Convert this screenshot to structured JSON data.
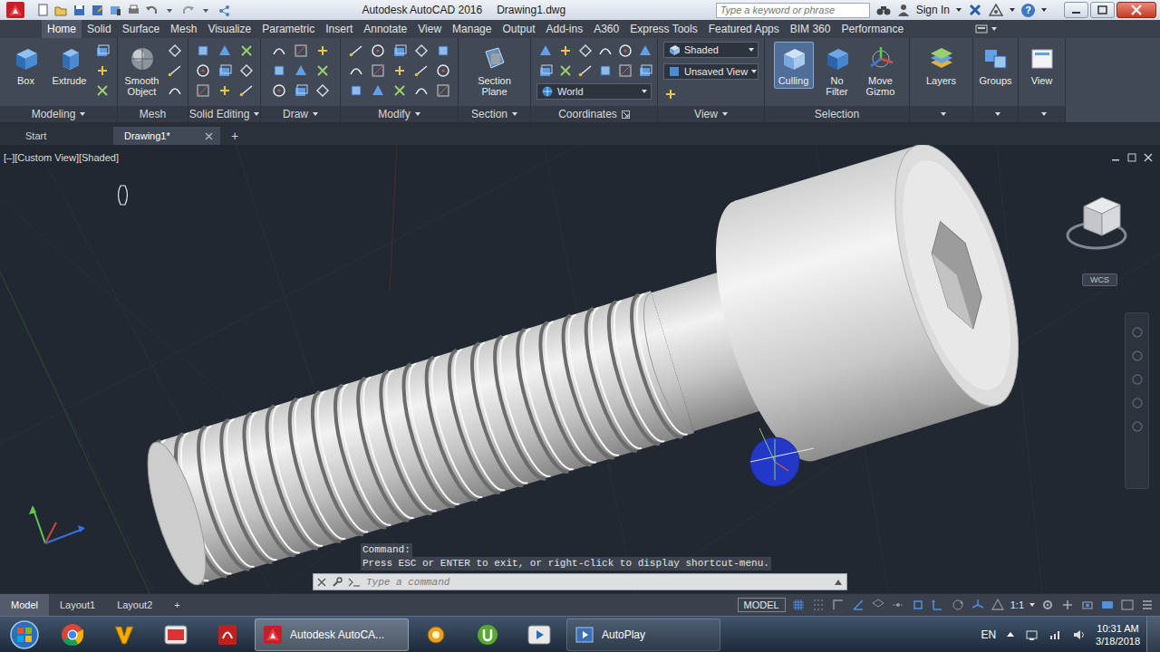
{
  "title_bar": {
    "app": "Autodesk AutoCAD 2016",
    "file": "Drawing1.dwg",
    "search": {
      "placeholder": "Type a keyword or phrase"
    },
    "sign_in": "Sign In",
    "help": "?"
  },
  "ribbon_tabs": [
    {
      "label": "Home",
      "selected": true
    },
    {
      "label": "Solid",
      "selected": false
    },
    {
      "label": "Surface",
      "selected": false
    },
    {
      "label": "Mesh",
      "selected": false
    },
    {
      "label": "Visualize",
      "selected": false
    },
    {
      "label": "Parametric",
      "selected": false
    },
    {
      "label": "Insert",
      "selected": false
    },
    {
      "label": "Annotate",
      "selected": false
    },
    {
      "label": "View",
      "selected": false
    },
    {
      "label": "Manage",
      "selected": false
    },
    {
      "label": "Output",
      "selected": false
    },
    {
      "label": "Add-ins",
      "selected": false
    },
    {
      "label": "A360",
      "selected": false
    },
    {
      "label": "Express Tools",
      "selected": false
    },
    {
      "label": "Featured Apps",
      "selected": false
    },
    {
      "label": "BIM 360",
      "selected": false
    },
    {
      "label": "Performance",
      "selected": false
    }
  ],
  "ribbon_panels": [
    {
      "label": "Modeling",
      "menu": true,
      "big_buttons": [
        {
          "label": "Box",
          "selected": false
        },
        {
          "label": "Extrude",
          "selected": false
        }
      ],
      "dropdowns": []
    },
    {
      "label": "Mesh",
      "menu": false,
      "big_buttons": [
        {
          "label": "Smooth Object",
          "selected": false
        }
      ],
      "dropdowns": []
    },
    {
      "label": "Solid Editing",
      "menu": true,
      "big_buttons": [],
      "dropdowns": []
    },
    {
      "label": "Draw",
      "menu": true,
      "big_buttons": [],
      "dropdowns": []
    },
    {
      "label": "Modify",
      "menu": true,
      "big_buttons": [],
      "dropdowns": []
    },
    {
      "label": "Section",
      "menu": true,
      "big_buttons": [
        {
          "label": "Section Plane",
          "selected": false
        }
      ],
      "dropdowns": []
    },
    {
      "label": "Coordinates",
      "menu": false,
      "big_buttons": [],
      "dropdowns": [
        {
          "label": "World"
        }
      ]
    },
    {
      "label": "View",
      "menu": true,
      "big_buttons": [],
      "dropdowns": [
        {
          "label": "Shaded"
        },
        {
          "label": "Unsaved View"
        }
      ]
    },
    {
      "label": "Selection",
      "menu": false,
      "big_buttons": [
        {
          "label": "Culling",
          "selected": true
        },
        {
          "label": "No Filter",
          "selected": false
        },
        {
          "label": "Move Gizmo",
          "selected": false
        }
      ],
      "dropdowns": []
    },
    {
      "label": "",
      "menu": true,
      "big_buttons": [
        {
          "label": "Layers",
          "selected": false
        }
      ],
      "dropdowns": []
    },
    {
      "label": "",
      "menu": true,
      "big_buttons": [
        {
          "label": "Groups",
          "selected": false
        }
      ],
      "dropdowns": []
    },
    {
      "label": "",
      "menu": true,
      "big_buttons": [
        {
          "label": "View",
          "selected": false
        }
      ],
      "dropdowns": []
    }
  ],
  "file_tabs": [
    {
      "label": "Start",
      "selected": false,
      "closable": false
    },
    {
      "label": "Drawing1*",
      "selected": true,
      "closable": true
    }
  ],
  "file_tab_new": "+",
  "viewport": {
    "label": "[–][Custom View][Shaded]",
    "wcs": "WCS"
  },
  "command_line": {
    "history": [
      "Command:",
      "Press ESC or ENTER to exit, or right-click to display shortcut-menu."
    ],
    "placeholder": "Type a command"
  },
  "layout_tabs": [
    {
      "label": "Model",
      "selected": true
    },
    {
      "label": "Layout1",
      "selected": false
    },
    {
      "label": "Layout2",
      "selected": false
    }
  ],
  "layout_tab_new": "+",
  "status_bar": {
    "space": "MODEL",
    "scale": "1:1"
  },
  "taskbar": {
    "buttons": [
      {
        "label": "Autodesk AutoCA...",
        "selected": true
      },
      {
        "label": "AutoPlay",
        "selected": false
      }
    ],
    "language": "EN",
    "time": "10:31 AM",
    "date": "3/18/2018"
  }
}
